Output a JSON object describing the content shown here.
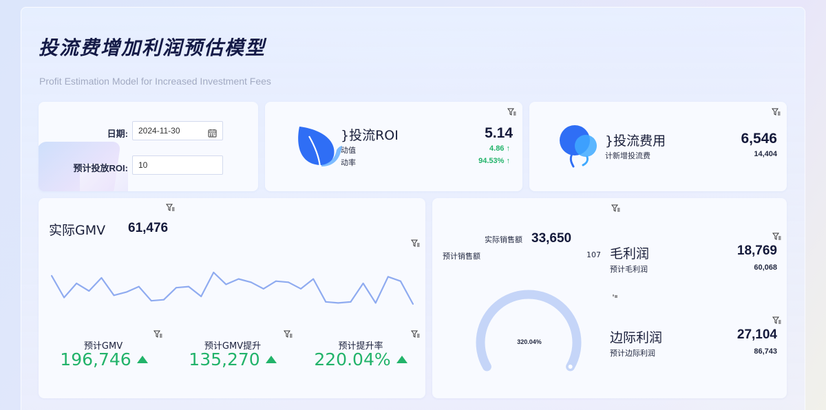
{
  "header": {
    "title": "投流费增加利润预估模型",
    "subtitle": "Profit Estimation Model for Increased Investment Fees"
  },
  "controls": {
    "date_label": "日期:",
    "date_value": "2024-11-30",
    "roi_label": "预计投放ROI:",
    "roi_value": "10"
  },
  "roi_card": {
    "name": "}投流ROI",
    "value": "5.14",
    "change_label": "动值",
    "change_value": "4.86",
    "rate_label": "动率",
    "rate_value": "94.53%"
  },
  "fee_card": {
    "name": "}投流费用",
    "value": "6,546",
    "sub_label": "计新增投流费",
    "sub_value": "14,404"
  },
  "gmv_card": {
    "title": "实际GMV",
    "value": "61,476",
    "stats": [
      {
        "label": "预计GMV",
        "value": "196,746"
      },
      {
        "label": "预计GMV提升",
        "value": "135,270"
      },
      {
        "label": "预计提升率",
        "value": "220.04%"
      }
    ]
  },
  "profit_card": {
    "actual_sales_label": "实际销售额",
    "actual_sales_value": "33,650",
    "expected_sales_label": "预计销售额",
    "expected_sales_value": "107",
    "gauge_label": "320.04%",
    "gross_name": "毛利润",
    "gross_value": "18,769",
    "gross_sub_label": "预计毛利润",
    "gross_sub_value": "60,068",
    "marginal_name": "边际利润",
    "marginal_value": "27,104",
    "marginal_sub_label": "预计边际利润",
    "marginal_sub_value": "86,743"
  },
  "colors": {
    "accent_blue": "#2f6ef5",
    "line_blue": "#8fabf0",
    "positive_green": "#22b36a",
    "gauge_track": "#c5d5f8"
  },
  "gauge_fraction": 0.8,
  "chart_data": {
    "type": "line",
    "series": [
      {
        "values": [
          27,
          7,
          20,
          13,
          25,
          9,
          12,
          17,
          4,
          5,
          16,
          17,
          8,
          30,
          19,
          24,
          21,
          15,
          22,
          21,
          15,
          24,
          3,
          2,
          3,
          20,
          2,
          26,
          22,
          1
        ]
      }
    ],
    "grid": false,
    "xlabel": "",
    "ylabel": ""
  }
}
